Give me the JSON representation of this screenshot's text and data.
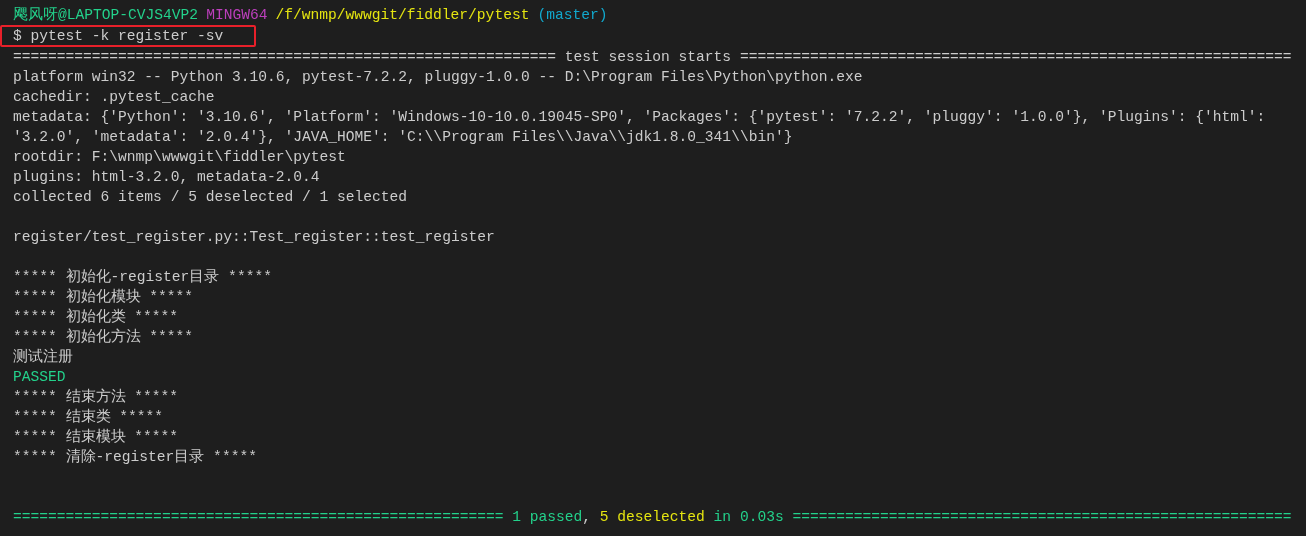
{
  "prompt": {
    "user_host": "飔风呀@LAPTOP-CVJS4VP2",
    "shell": "MINGW64",
    "path": "/f/wnmp/wwwgit/fiddler/pytest",
    "branch": "(master)"
  },
  "command": {
    "text": "$ pytest -k register -sv",
    "highlighted": true
  },
  "output_blocks": [
    [
      {
        "kind": "text",
        "text": "============================================================== test session starts ==============================================================="
      },
      {
        "kind": "text",
        "text": "platform win32 -- Python 3.10.6, pytest-7.2.2, pluggy-1.0.0 -- D:\\Program Files\\Python\\python.exe"
      },
      {
        "kind": "text",
        "text": "cachedir: .pytest_cache"
      },
      {
        "kind": "text",
        "text": "metadata: {'Python': '3.10.6', 'Platform': 'Windows-10-10.0.19045-SP0', 'Packages': {'pytest': '7.2.2', 'pluggy': '1.0.0'}, 'Plugins': {'html':"
      },
      {
        "kind": "text",
        "text": "'3.2.0', 'metadata': '2.0.4'}, 'JAVA_HOME': 'C:\\\\Program Files\\\\Java\\\\jdk1.8.0_341\\\\bin'}"
      },
      {
        "kind": "text",
        "text": "rootdir: F:\\wnmp\\wwwgit\\fiddler\\pytest"
      },
      {
        "kind": "text",
        "text": "plugins: html-3.2.0, metadata-2.0.4"
      },
      {
        "kind": "text",
        "text": "collected 6 items / 5 deselected / 1 selected"
      }
    ],
    [
      {
        "kind": "text",
        "text": "register/test_register.py::Test_register::test_register"
      }
    ],
    [
      {
        "kind": "text",
        "text": "***** 初始化-register目录 *****"
      },
      {
        "kind": "text",
        "text": "***** 初始化模块 *****"
      },
      {
        "kind": "text",
        "text": "***** 初始化类 *****"
      },
      {
        "kind": "text",
        "text": "***** 初始化方法 *****"
      },
      {
        "kind": "text",
        "text": "测试注册"
      },
      {
        "kind": "passed",
        "text": "PASSED"
      },
      {
        "kind": "text",
        "text": "***** 结束方法 *****"
      },
      {
        "kind": "text",
        "text": "***** 结束类 *****"
      },
      {
        "kind": "text",
        "text": "***** 结束模块 *****"
      },
      {
        "kind": "text",
        "text": "***** 清除-register目录 *****"
      }
    ]
  ],
  "summary": [
    {
      "text": "======================================================== 1 passed",
      "color": "#23d18b"
    },
    {
      "text": ", ",
      "color": "#cccccc"
    },
    {
      "text": "5 deselected",
      "color": "#e5e510"
    },
    {
      "text": " in 0.03s =========================================================",
      "color": "#23d18b"
    }
  ]
}
